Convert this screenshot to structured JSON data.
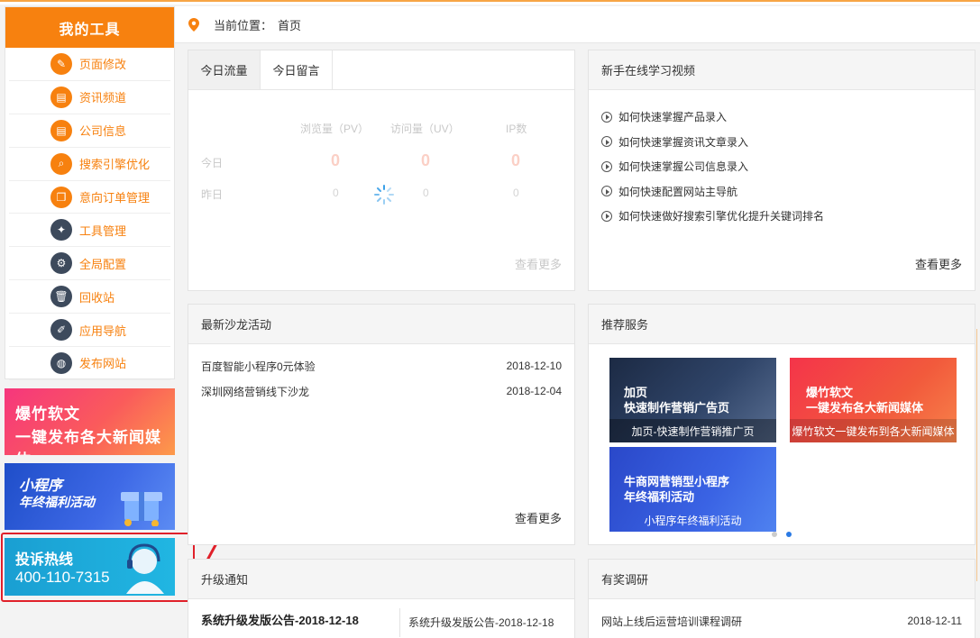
{
  "sidebar": {
    "title": "我的工具",
    "items": [
      {
        "label": "页面修改",
        "icon": "edit-icon",
        "color": "orange",
        "glyph": "✎"
      },
      {
        "label": "资讯频道",
        "icon": "news-icon",
        "color": "orange",
        "glyph": "▤"
      },
      {
        "label": "公司信息",
        "icon": "company-icon",
        "color": "orange",
        "glyph": "▤"
      },
      {
        "label": "搜索引擎优化",
        "icon": "search-icon",
        "color": "orange",
        "glyph": "⌕"
      },
      {
        "label": "意向订单管理",
        "icon": "order-icon",
        "color": "orange",
        "glyph": "❐"
      },
      {
        "label": "工具管理",
        "icon": "wrench-icon",
        "color": "dark",
        "glyph": "✦"
      },
      {
        "label": "全局配置",
        "icon": "gear-icon",
        "color": "dark",
        "glyph": "⚙"
      },
      {
        "label": "回收站",
        "icon": "trash-icon",
        "color": "dark",
        "glyph": "🗑"
      },
      {
        "label": "应用导航",
        "icon": "brush-icon",
        "color": "dark",
        "glyph": "✐"
      },
      {
        "label": "发布网站",
        "icon": "globe-icon",
        "color": "dark",
        "glyph": "◍"
      }
    ]
  },
  "banners": {
    "b1_line1": "爆竹软文",
    "b1_line2": "一键发布各大新闻媒体",
    "b2_line1": "小程序",
    "b2_line2": "年终福利活动",
    "b3_line1": "投诉热线",
    "b3_line2": "400-110-7315"
  },
  "breadcrumb": {
    "label": "当前位置：",
    "page": "首页"
  },
  "traffic": {
    "tabs": [
      "今日流量",
      "今日留言"
    ],
    "headers": [
      "浏览量（PV）",
      "访问量（UV）",
      "IP数"
    ],
    "rows": [
      {
        "label": "今日",
        "values": [
          "0",
          "0",
          "0"
        ]
      },
      {
        "label": "昨日",
        "values": [
          "0",
          "0",
          "0"
        ]
      }
    ],
    "more": "查看更多"
  },
  "videos": {
    "title": "新手在线学习视频",
    "items": [
      "如何快速掌握产品录入",
      "如何快速掌握资讯文章录入",
      "如何快速掌握公司信息录入",
      "如何快速配置网站主导航",
      "如何快速做好搜索引擎优化提升关键词排名"
    ],
    "more": "查看更多"
  },
  "salon": {
    "title": "最新沙龙活动",
    "items": [
      {
        "name": "百度智能小程序0元体验",
        "date": "2018-12-10"
      },
      {
        "name": "深圳网络营销线下沙龙",
        "date": "2018-12-04"
      }
    ],
    "more": "查看更多"
  },
  "services": {
    "title": "推荐服务",
    "cards": [
      {
        "big1": "加页",
        "big2": "快速制作营销广告页",
        "caption": "加页-快速制作营销推广页"
      },
      {
        "big1": "爆竹软文",
        "big2": "一键发布各大新闻媒体",
        "caption": "爆竹软文一键发布到各大新闻媒体"
      },
      {
        "big1": "牛商网营销型小程序",
        "big2": "年终福利活动",
        "caption": "小程序年终福利活动"
      }
    ]
  },
  "upgrade": {
    "title": "升级通知",
    "main": "系统升级发版公告-2018-12-18",
    "side": "系统升级发版公告-2018-12-18"
  },
  "survey": {
    "title": "有奖调研",
    "item": "网站上线后运营培训课程调研",
    "date": "2018-12-11"
  }
}
